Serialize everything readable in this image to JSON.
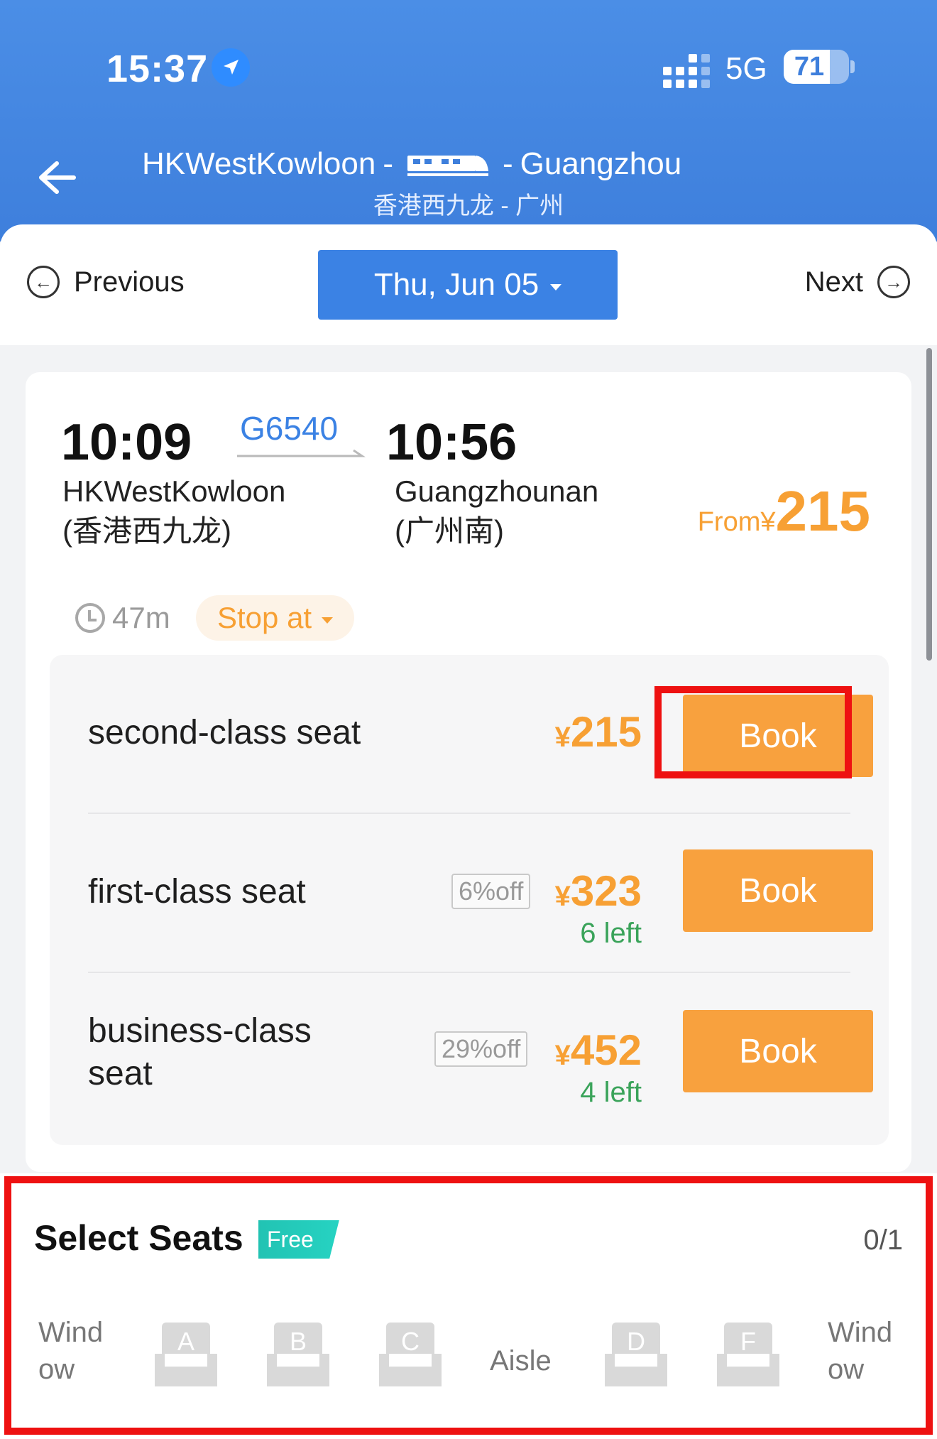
{
  "status_bar": {
    "time": "15:37",
    "network": "5G",
    "battery": "71",
    "battery_level": 0.71
  },
  "header": {
    "from": "HKWestKowloon",
    "to": "Guangzhou",
    "from_sep": "-",
    "to_sep": "-",
    "subtitle": "香港西九龙 - 广州",
    "icons": [
      "back-arrow-icon",
      "train-icon"
    ]
  },
  "date_bar": {
    "previous_label": "Previous",
    "next_label": "Next",
    "date": "Thu, Jun 05"
  },
  "train": {
    "depart_time": "10:09",
    "arrive_time": "10:56",
    "number": "G6540",
    "from_station": "HKWestKowloon",
    "from_station_cn": "(香港西九龙)",
    "to_station": "Guangzhounan",
    "to_station_cn": "(广州南)",
    "from_label": "From",
    "from_currency": "¥",
    "from_price": "215",
    "duration": "47m",
    "stop_at_label": "Stop at"
  },
  "seats": [
    {
      "name": "second-class seat",
      "currency": "¥",
      "price": "215",
      "discount": "",
      "left": "",
      "book_label": "Book"
    },
    {
      "name": "first-class seat",
      "currency": "¥",
      "price": "323",
      "discount": "6%off",
      "left": "6 left",
      "book_label": "Book"
    },
    {
      "name_line1": "business-class",
      "name_line2": "seat",
      "currency": "¥",
      "price": "452",
      "discount": "29%off",
      "left": "4 left",
      "book_label": "Book"
    }
  ],
  "seat_select": {
    "title": "Select Seats",
    "tag": "Free",
    "count": "0/1",
    "window_left_l1": "Wind",
    "window_left_l2": "ow",
    "window_right_l1": "Wind",
    "window_right_l2": "ow",
    "aisle": "Aisle",
    "letters": [
      "A",
      "B",
      "C",
      "D",
      "F"
    ]
  },
  "colors": {
    "header_blue": "#3e7fdc",
    "accent_blue": "#3b82e4",
    "orange": "#f7a034",
    "green": "#3aa35a",
    "highlight_red": "#ee1111"
  }
}
